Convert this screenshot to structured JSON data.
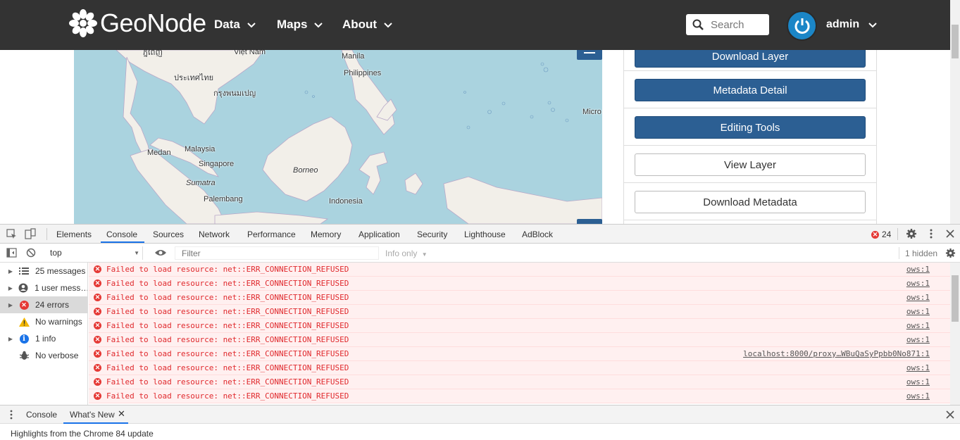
{
  "navbar": {
    "brand": "GeoNode",
    "menu": [
      {
        "label": "Data"
      },
      {
        "label": "Maps"
      },
      {
        "label": "About"
      }
    ],
    "search": {
      "placeholder": "Search"
    },
    "user": "admin"
  },
  "map": {
    "labels": [
      "ประเทศไทย",
      "Việt Nam",
      "Manila",
      "Philippines",
      "กรุงพนมเปญ",
      "Medan",
      "Malaysia",
      "Singapore",
      "Sumatra",
      "Palembang",
      "Borneo",
      "Indonesia",
      "Micro",
      "ភ្នំពេញ"
    ]
  },
  "sidebar": {
    "buttons": [
      "Download Layer",
      "Metadata Detail",
      "Editing Tools",
      "View Layer",
      "Download Metadata"
    ]
  },
  "devtools": {
    "tabs": [
      "Elements",
      "Console",
      "Sources",
      "Network",
      "Performance",
      "Memory",
      "Application",
      "Security",
      "Lighthouse",
      "AdBlock"
    ],
    "active_tab": "Console",
    "error_count": "24",
    "context": "top",
    "filter_placeholder": "Filter",
    "levels": "Info only",
    "hidden": "1 hidden",
    "sidebar": [
      {
        "label": "25 messages"
      },
      {
        "label": "1 user mess…"
      },
      {
        "label": "24 errors"
      },
      {
        "label": "No warnings"
      },
      {
        "label": "1 info"
      },
      {
        "label": "No verbose"
      }
    ],
    "messages": [
      {
        "text": "Failed to load resource: net::ERR_CONNECTION_REFUSED",
        "source": "ows:1"
      },
      {
        "text": "Failed to load resource: net::ERR_CONNECTION_REFUSED",
        "source": "ows:1"
      },
      {
        "text": "Failed to load resource: net::ERR_CONNECTION_REFUSED",
        "source": "ows:1"
      },
      {
        "text": "Failed to load resource: net::ERR_CONNECTION_REFUSED",
        "source": "ows:1"
      },
      {
        "text": "Failed to load resource: net::ERR_CONNECTION_REFUSED",
        "source": "ows:1"
      },
      {
        "text": "Failed to load resource: net::ERR_CONNECTION_REFUSED",
        "source": "ows:1"
      },
      {
        "text": "Failed to load resource: net::ERR_CONNECTION_REFUSED",
        "source": "localhost:8000/proxy…WBuQaSyPpbb0No871:1"
      },
      {
        "text": "Failed to load resource: net::ERR_CONNECTION_REFUSED",
        "source": "ows:1"
      },
      {
        "text": "Failed to load resource: net::ERR_CONNECTION_REFUSED",
        "source": "ows:1"
      },
      {
        "text": "Failed to load resource: net::ERR_CONNECTION_REFUSED",
        "source": "ows:1"
      }
    ],
    "drawer_tabs": [
      "Console",
      "What's New"
    ],
    "drawer_text": "Highlights from the Chrome 84 update"
  },
  "colors": {
    "navbar": "#333333",
    "primary_button": "#2c5f93",
    "error_text": "#e0292d",
    "error_bg": "#fff0f0",
    "sea": "#aad3df",
    "land": "#f2efe9"
  }
}
